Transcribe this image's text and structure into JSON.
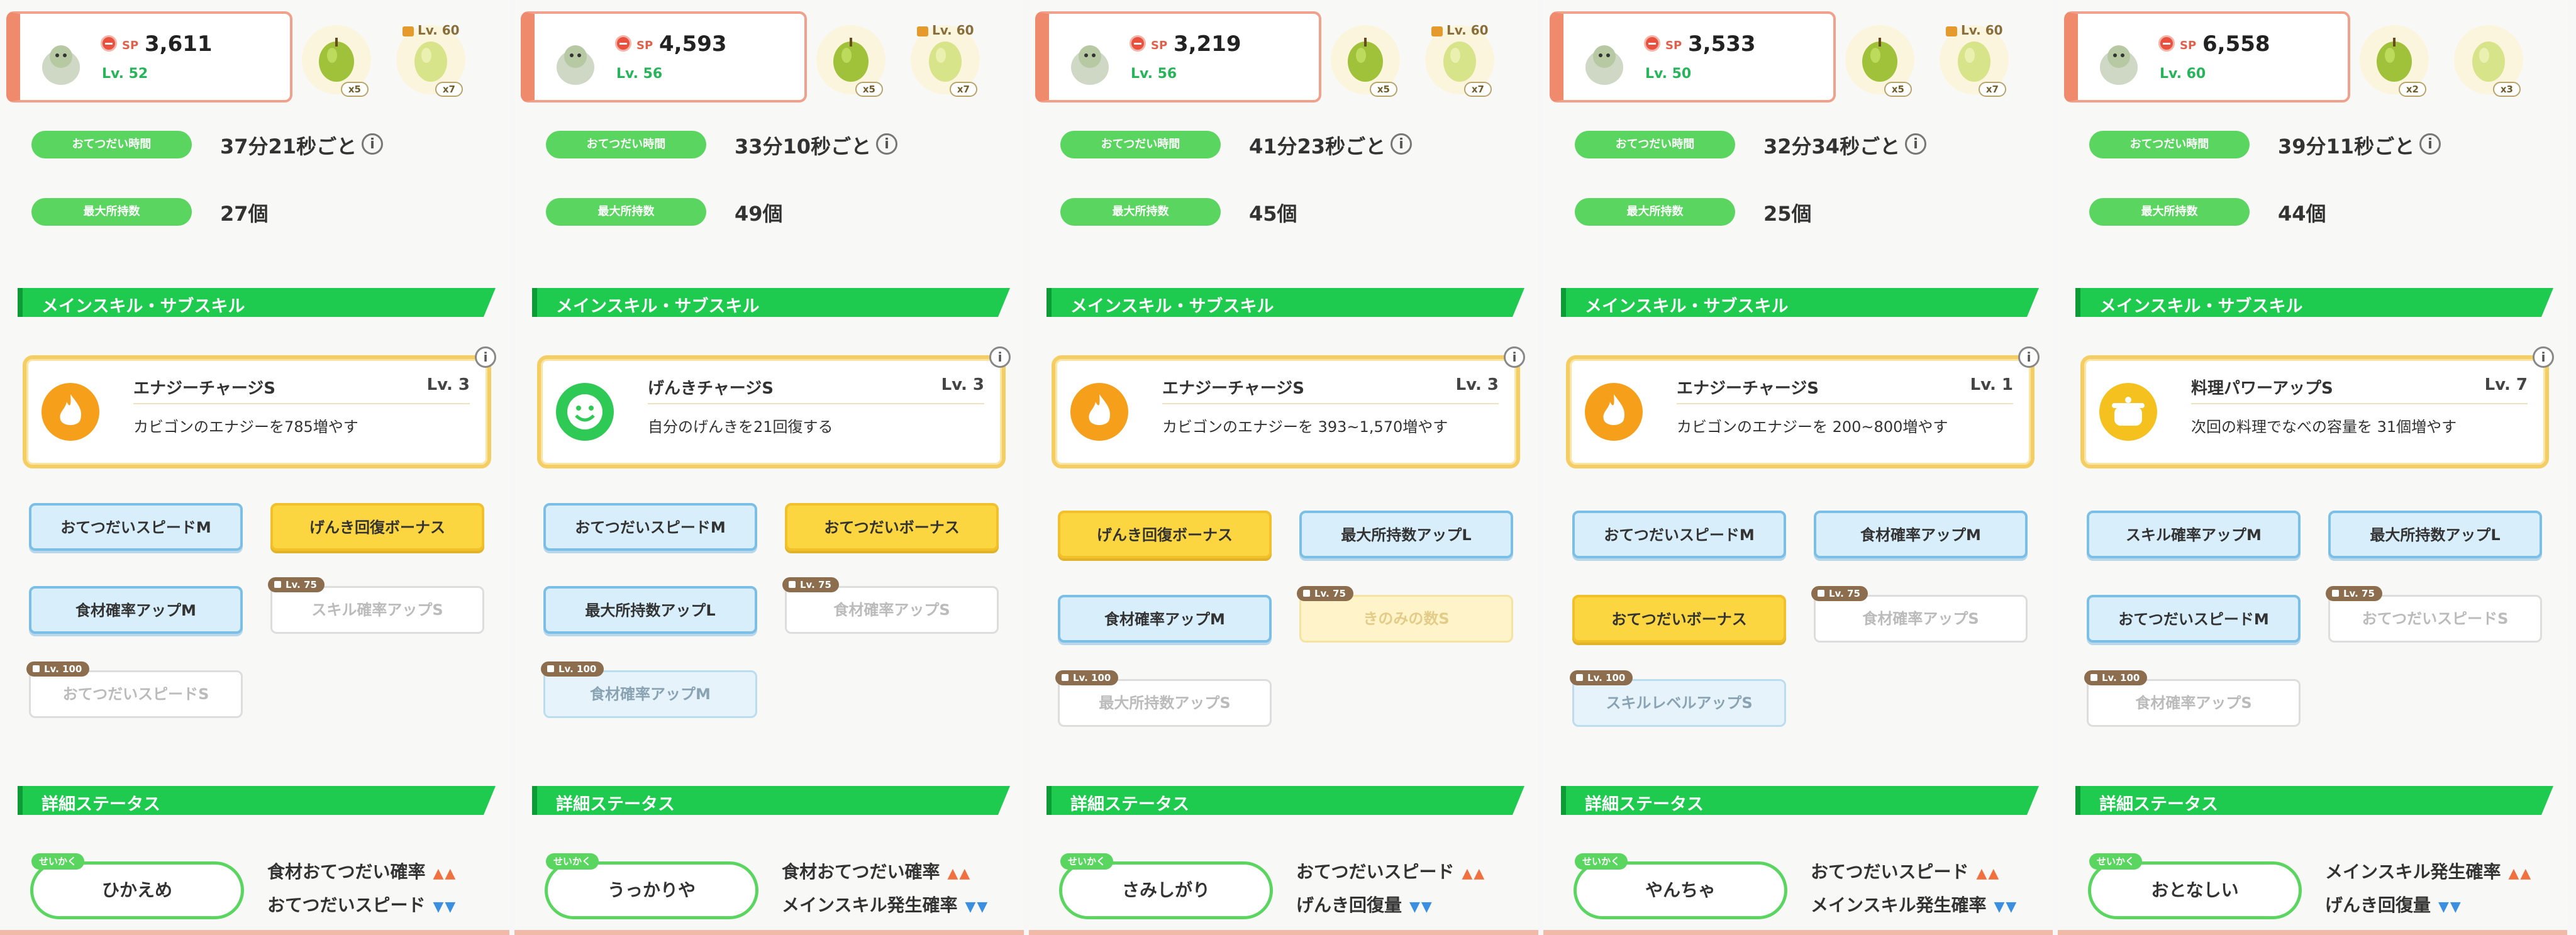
{
  "labels": {
    "sp": "SP",
    "help_time": "おてつだい時間",
    "max_carry": "最大所持数",
    "skills_section": "メインスキル・サブスキル",
    "details_section": "詳細ステータス",
    "nature_badge": "せいかく",
    "info": "i"
  },
  "colors": {
    "accent_green": "#1ecb4f",
    "sp_red": "#e9503e",
    "skill_gold": "#f4cd63"
  },
  "panels": [
    {
      "sp": "3,611",
      "level": "Lv. 52",
      "ing1": {
        "icon": "green-apple-icon",
        "count": "x5"
      },
      "ing2": {
        "icon": "green-apple-icon",
        "count": "x7",
        "lock": "Lv. 60"
      },
      "help_time": "37分21秒ごと",
      "max_carry": "27個",
      "skill": {
        "name": "エナジーチャージS",
        "level": "Lv. 3",
        "desc": "カビゴンのエナジーを785増やす",
        "icon": "flame-icon"
      },
      "subs": [
        {
          "label": "おてつだいスピードM"
        },
        {
          "label": "げんき回復ボーナス"
        },
        {
          "label": "食材確率アップM"
        },
        {
          "label": "スキル確率アップS",
          "lock": "Lv. 75"
        },
        {
          "label": "おてつだいスピードS",
          "lock": "Lv. 100"
        }
      ],
      "nature": "ひかえめ",
      "up": "食材おてつだい確率",
      "down": "おてつだいスピード",
      "up_mark": "▲▲",
      "down_mark": "▼▼"
    },
    {
      "sp": "4,593",
      "level": "Lv. 56",
      "ing1": {
        "icon": "leek-icon",
        "count": "x5"
      },
      "ing2": {
        "icon": "corn-icon",
        "count": "x7",
        "lock": "Lv. 60"
      },
      "help_time": "33分10秒ごと",
      "max_carry": "49個",
      "skill": {
        "name": "げんきチャージS",
        "level": "Lv. 3",
        "desc": "自分のげんきを21回復する",
        "icon": "smile-icon"
      },
      "subs": [
        {
          "label": "おてつだいスピードM"
        },
        {
          "label": "おてつだいボーナス"
        },
        {
          "label": "最大所持数アップL"
        },
        {
          "label": "食材確率アップS",
          "lock": "Lv. 75"
        },
        {
          "label": "食材確率アップM",
          "lock": "Lv. 100"
        }
      ],
      "nature": "うっかりや",
      "up": "食材おてつだい確率",
      "down": "メインスキル発生確率",
      "up_mark": "▲▲",
      "down_mark": "▼▼"
    },
    {
      "sp": "3,219",
      "level": "Lv. 56",
      "ing1": {
        "icon": "potato-icon",
        "count": "x5"
      },
      "ing2": {
        "icon": "potato-icon",
        "count": "x7",
        "lock": "Lv. 60"
      },
      "help_time": "41分23秒ごと",
      "max_carry": "45個",
      "skill": {
        "name": "エナジーチャージS",
        "level": "Lv. 3",
        "desc": "カビゴンのエナジーを 393~1,570増やす",
        "icon": "flame-icon"
      },
      "subs": [
        {
          "label": "げんき回復ボーナス"
        },
        {
          "label": "最大所持数アップL"
        },
        {
          "label": "食材確率アップM"
        },
        {
          "label": "きのみの数S",
          "lock": "Lv. 75"
        },
        {
          "label": "最大所持数アップS",
          "lock": "Lv. 100"
        }
      ],
      "nature": "さみしがり",
      "up": "おてつだいスピード",
      "down": "げんき回復量",
      "up_mark": "▲▲",
      "down_mark": "▼▼"
    },
    {
      "sp": "3,533",
      "level": "Lv. 50",
      "ing1": {
        "icon": "corn-icon",
        "count": "x5"
      },
      "ing2": {
        "icon": "corn-icon",
        "count": "x7",
        "lock": "Lv. 60"
      },
      "help_time": "32分34秒ごと",
      "max_carry": "25個",
      "skill": {
        "name": "エナジーチャージS",
        "level": "Lv. 1",
        "desc": "カビゴンのエナジーを 200~800増やす",
        "icon": "flame-icon"
      },
      "subs": [
        {
          "label": "おてつだいスピードM"
        },
        {
          "label": "食材確率アップM"
        },
        {
          "label": "おてつだいボーナス"
        },
        {
          "label": "食材確率アップS",
          "lock": "Lv. 75"
        },
        {
          "label": "スキルレベルアップS",
          "lock": "Lv. 100"
        }
      ],
      "nature": "やんちゃ",
      "up": "おてつだいスピード",
      "down": "メインスキル発生確率",
      "up_mark": "▲▲",
      "down_mark": "▼▼"
    },
    {
      "sp": "6,558",
      "level": "Lv. 60",
      "ing1": {
        "icon": "leek-icon",
        "count": "x2"
      },
      "ing2": {
        "icon": "leek-icon",
        "count": "x3"
      },
      "help_time": "39分11秒ごと",
      "max_carry": "44個",
      "skill": {
        "name": "料理パワーアップS",
        "level": "Lv. 7",
        "desc": "次回の料理でなべの容量を 31個増やす",
        "icon": "pot-icon"
      },
      "subs": [
        {
          "label": "スキル確率アップM"
        },
        {
          "label": "最大所持数アップL"
        },
        {
          "label": "おてつだいスピードM"
        },
        {
          "label": "おてつだいスピードS",
          "lock": "Lv. 75"
        },
        {
          "label": "食材確率アップS",
          "lock": "Lv. 100"
        }
      ],
      "nature": "おとなしい",
      "up": "メインスキル発生確率",
      "down": "げんき回復量",
      "up_mark": "▲▲",
      "down_mark": "▼▼"
    }
  ]
}
